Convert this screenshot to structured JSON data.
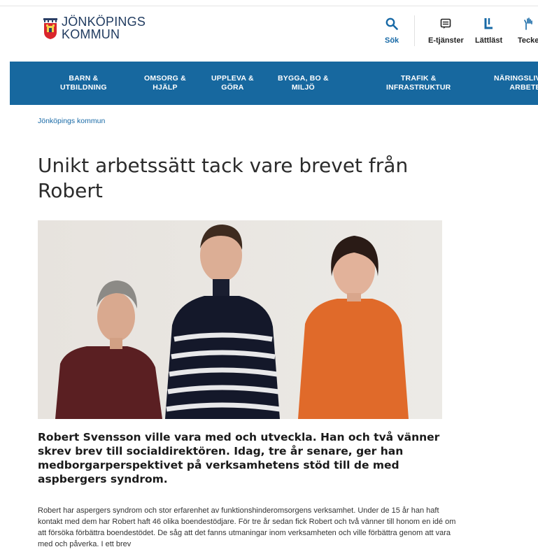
{
  "header": {
    "logo_line1": "JÖNKÖPINGS",
    "logo_line2": "KOMMUN",
    "utilities": {
      "search": "Sök",
      "e_services": "E-tjänster",
      "easy_read": "Lättläst",
      "sign_language": "Tecke"
    }
  },
  "nav": {
    "items": [
      {
        "line1": "BARN &",
        "line2": "UTBILDNING"
      },
      {
        "line1": "OMSORG &",
        "line2": "HJÄLP"
      },
      {
        "line1": "UPPLEVA &",
        "line2": "GÖRA"
      },
      {
        "line1": "BYGGA, BO &",
        "line2": "MILJÖ"
      },
      {
        "line1": "TRAFIK &",
        "line2": "INFRASTRUKTUR"
      },
      {
        "line1": "NÄRINGSLIV",
        "line2": "ARBETE"
      }
    ]
  },
  "breadcrumb": "Jönköpings kommun",
  "article": {
    "title": "Unikt arbetssätt tack vare brevet från Robert",
    "lead": "Robert Svensson ville vara med och utveckla. Han och två vänner skrev brev till socialdirektören. Idag, tre år senare, ger han medborgarperspektivet på verksamhetens stöd till de med aspbergers syndrom.",
    "body": "Robert har aspergers syndrom och stor erfarenhet av funktionshinderomsorgens verksamhet. Under de 15 år han haft kontakt med dem har Robert haft 46 olika boendestödjare. För tre år sedan fick Robert och två vänner till honom en idé om att försöka förbättra boendestödet. De såg att det fanns utmaningar inom verksamheten och ville förbättra genom att vara med och påverka. I ett brev"
  },
  "colors": {
    "nav_bg": "#17689f",
    "link": "#1769a6",
    "logo": "#1f3a5f"
  }
}
